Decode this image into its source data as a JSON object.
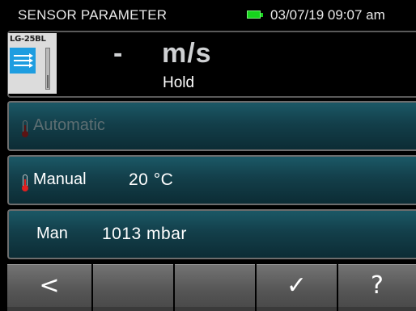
{
  "status_bar": {
    "title": "SENSOR PARAMETER",
    "datetime": "03/07/19 09:07 am",
    "battery_icon": "battery-full-icon",
    "battery_color": "#16d51c"
  },
  "sensor": {
    "model": "LG-25BL",
    "icon": "flow-sensor-icon",
    "icon_color": "#1e9de0",
    "value": "-",
    "unit": "m/s",
    "hold_label": "Hold"
  },
  "options": {
    "automatic": {
      "label": "Automatic",
      "icon": "thermometer-icon",
      "enabled": false
    },
    "manual": {
      "label": "Manual",
      "value": "20 °C",
      "icon": "thermometer-icon"
    },
    "pressure": {
      "label": "Man",
      "value": "1013 mbar"
    }
  },
  "buttons": [
    {
      "name": "back-button",
      "glyph": "<",
      "icon": "chevron-left-icon"
    },
    {
      "name": "empty-button-2",
      "glyph": ""
    },
    {
      "name": "empty-button-3",
      "glyph": ""
    },
    {
      "name": "confirm-button",
      "glyph": "✓",
      "icon": "checkmark-icon"
    },
    {
      "name": "help-button",
      "glyph": "?",
      "icon": "question-icon"
    }
  ],
  "colors": {
    "row_gradient_top": "#1b5866",
    "row_gradient_bottom": "#0c2c35",
    "thermometer_red": "#e02020"
  }
}
